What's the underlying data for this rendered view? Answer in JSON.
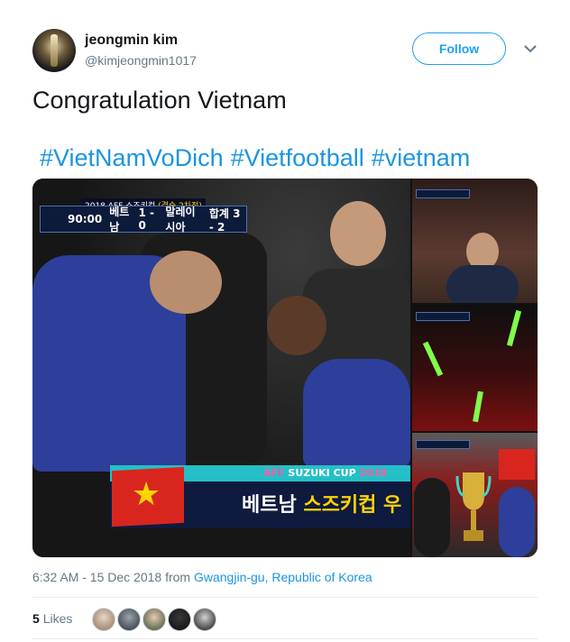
{
  "author": {
    "name": "jeongmin kim",
    "handle": "@kimjeongmin1017"
  },
  "follow_label": "Follow",
  "tweet": {
    "text": "Congratulation Vietnam",
    "hashtags": [
      "#VietNamVoDich",
      "#Vietfootball",
      "#vietnam"
    ]
  },
  "media": {
    "scoreboard": {
      "competition": "2018 AFF 스즈키컵",
      "round": "(결승 2차전)",
      "time": "90:00",
      "home": "베트남",
      "score": "1 - 0",
      "away": "말레이시아",
      "aggregate": "합계 3 - 2"
    },
    "banner": {
      "logo_prefix": "AFF",
      "logo_main": "SUZUKI CUP",
      "logo_year": "2018",
      "text_white": "베트남",
      "text_yellow": "스즈키컵 우"
    }
  },
  "timestamp": {
    "time_date": "6:32 AM - 15 Dec 2018 from",
    "location": "Gwangjin-gu, Republic of Korea"
  },
  "likes": {
    "count": "5",
    "label": "Likes"
  },
  "colors": {
    "brand_blue": "#1da1f2",
    "link_blue": "#1b95e0",
    "muted": "#657786"
  }
}
